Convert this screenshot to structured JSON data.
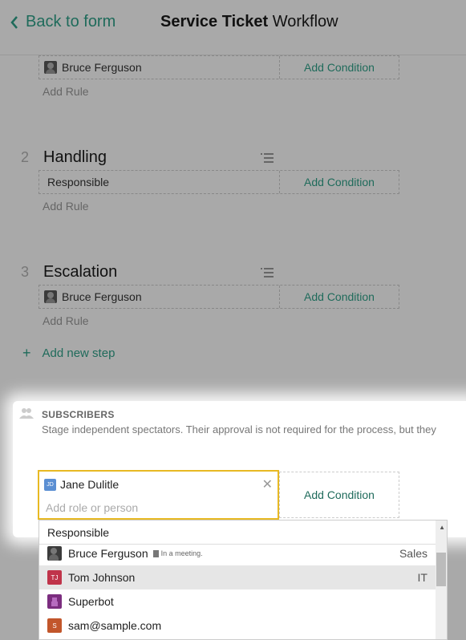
{
  "header": {
    "back_label": "Back to form",
    "title_bold": "Service Ticket",
    "title_rest": "Workflow"
  },
  "step1": {
    "rule_assignee": "Bruce Ferguson",
    "add_condition": "Add Condition",
    "add_rule": "Add Rule"
  },
  "step2": {
    "number": "2",
    "name": "Handling",
    "rule_assignee": "Responsible",
    "add_condition": "Add Condition",
    "add_rule": "Add Rule"
  },
  "step3": {
    "number": "3",
    "name": "Escalation",
    "rule_assignee": "Bruce Ferguson",
    "add_condition": "Add Condition",
    "add_rule": "Add Rule"
  },
  "add_new_step": "Add new step",
  "subscribers": {
    "title": "SUBSCRIBERS",
    "description": "Stage independent spectators. Their approval is not required for the process, but they",
    "chip_initials": "JD",
    "chip_name": "Jane Dulitle",
    "input_placeholder": "Add role or person",
    "add_condition": "Add Condition"
  },
  "dropdown": {
    "header": "Responsible",
    "items": [
      {
        "name": "Bruce Ferguson",
        "status": "In a meeting.",
        "dept": "Sales"
      },
      {
        "name": "Tom Johnson",
        "initials": "TJ",
        "dept": "IT",
        "color": "#c0344a"
      },
      {
        "name": "Superbot",
        "color": "#7b2d7f"
      },
      {
        "name": "sam@sample.com",
        "initials": "S",
        "color": "#c2562b"
      }
    ]
  },
  "colors": {
    "accent": "#1f6b5b",
    "highlight_border": "#e8b923"
  }
}
